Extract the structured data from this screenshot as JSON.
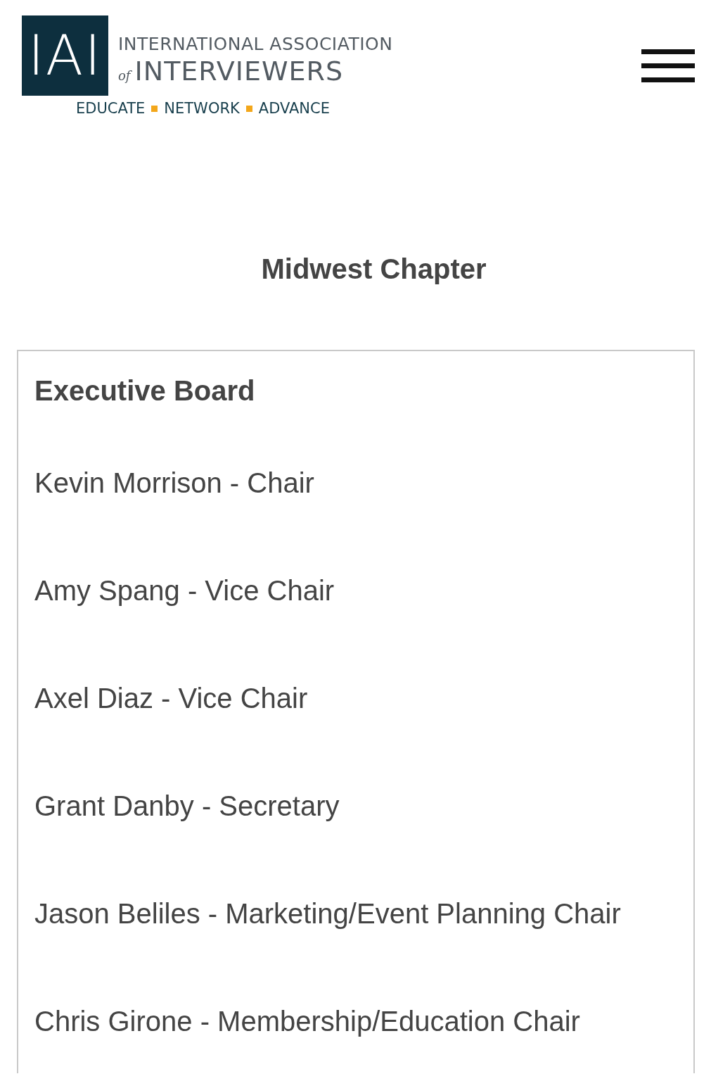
{
  "logo": {
    "mark": "IAI",
    "line_1": "INTERNATIONAL ASSOCIATION",
    "line_2_prefix": "of",
    "line_2": "INTERVIEWERS",
    "tagline": [
      "EDUCATE",
      "NETWORK",
      "ADVANCE"
    ]
  },
  "page_title": "Midwest Chapter",
  "card": {
    "heading": "Executive Board",
    "members": [
      "Kevin Morrison - Chair",
      "Amy Spang - Vice Chair",
      "Axel Diaz - Vice Chair",
      "Grant Danby - Secretary",
      "Jason Beliles - Marketing/Event Planning Chair",
      "Chris Girone - Membership/Education Chair"
    ]
  }
}
